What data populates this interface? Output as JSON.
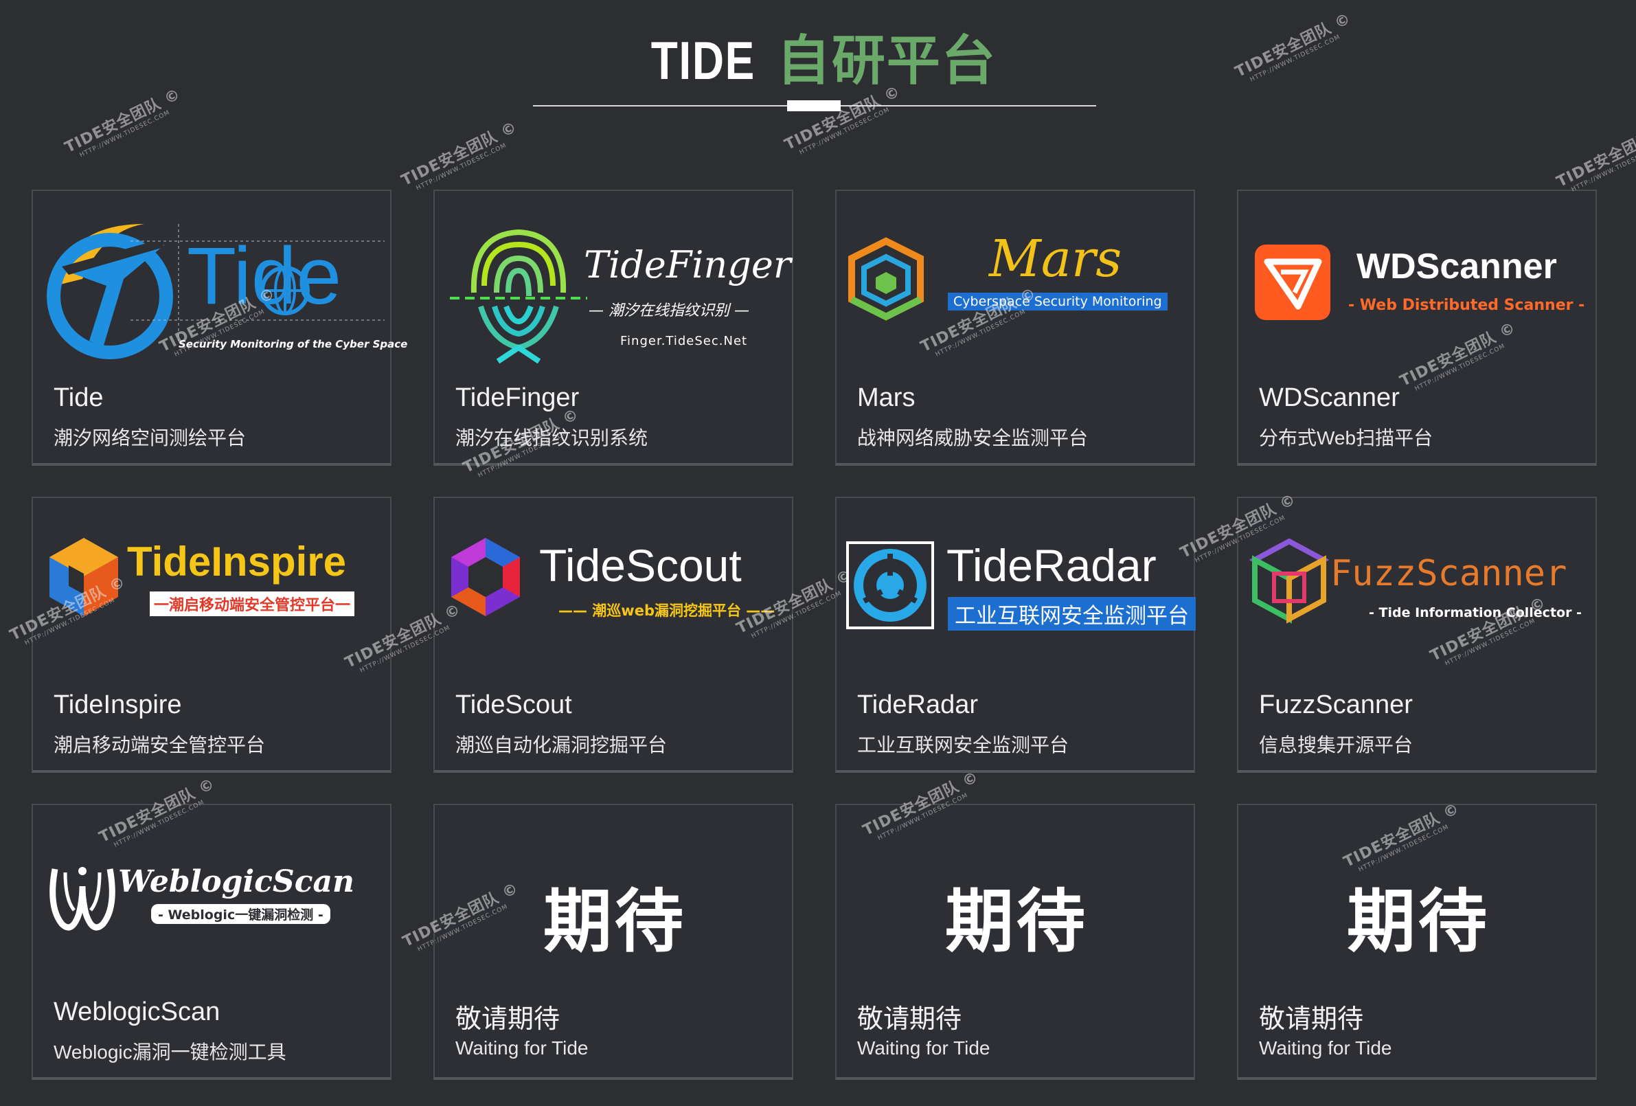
{
  "header": {
    "title_en": "TIDE",
    "title_cn": "自研平台"
  },
  "watermark": {
    "text": "TIDE安全团队 ©",
    "url": "HTTP://WWW.TIDESEC.COM"
  },
  "colors": {
    "accent_green": "#6aa96a",
    "background": "#2d2e32",
    "tide_blue": "#1f8fe0",
    "tide_yellow": "#f5b51c",
    "mars_yellow": "#f2c21a",
    "wds_orange": "#ff5a1f",
    "inspire_yellow": "#f5c518",
    "fuzz_orange": "#e87a2c"
  },
  "cards": [
    {
      "name": "Tide",
      "desc": "潮汐网络空间测绘平台",
      "logo": {
        "icon": "tide-logo-icon",
        "text": "Tide",
        "sub": "Security Monitoring of the Cyber Space"
      }
    },
    {
      "name": "TideFinger",
      "desc": "潮汐在线指纹识别系统",
      "logo": {
        "icon": "fingerprint-icon",
        "text": "TideFinger",
        "sub": "— 潮汐在线指纹识别 —",
        "url": "Finger.TideSec.Net"
      }
    },
    {
      "name": "Mars",
      "desc": "战神网络威胁安全监测平台",
      "logo": {
        "icon": "mars-cube-icon",
        "text": "Mars",
        "sub": "Cyberspace Security Monitoring"
      }
    },
    {
      "name": "WDScanner",
      "desc": "分布式Web扫描平台",
      "logo": {
        "icon": "wdscanner-icon",
        "text": "WDScanner",
        "sub": "- Web Distributed Scanner -"
      }
    },
    {
      "name": "TideInspire",
      "desc": "潮启移动端安全管控平台",
      "logo": {
        "icon": "inspire-hex-icon",
        "text": "TideInspire",
        "sub": "一潮启移动端安全管控平台一"
      }
    },
    {
      "name": "TideScout",
      "desc": "潮巡自动化漏洞挖掘平台",
      "logo": {
        "icon": "scout-hex-icon",
        "text": "TideScout",
        "sub": "—— 潮巡web漏洞挖掘平台 ——"
      }
    },
    {
      "name": "TideRadar",
      "desc": "工业互联网安全监测平台",
      "logo": {
        "icon": "radar-icon",
        "text": "TideRadar",
        "sub": "工业互联网安全监测平台"
      }
    },
    {
      "name": "FuzzScanner",
      "desc": "信息搜集开源平台",
      "logo": {
        "icon": "fuzz-cube-icon",
        "text": "FuzzScanner",
        "sub": "- Tide Information Collector -"
      }
    },
    {
      "name": "WeblogicScan",
      "desc": "Weblogic漏洞一键检测工具",
      "logo": {
        "icon": "weblogic-icon",
        "text": "WeblogicScan",
        "sub": "- Weblogic一键漏洞检测 -"
      }
    },
    {
      "name": "敬请期待",
      "desc": "Waiting for Tide",
      "logo": {
        "text": "期待"
      }
    },
    {
      "name": "敬请期待",
      "desc": "Waiting for Tide",
      "logo": {
        "text": "期待"
      }
    },
    {
      "name": "敬请期待",
      "desc": "Waiting for Tide",
      "logo": {
        "text": "期待"
      }
    }
  ]
}
